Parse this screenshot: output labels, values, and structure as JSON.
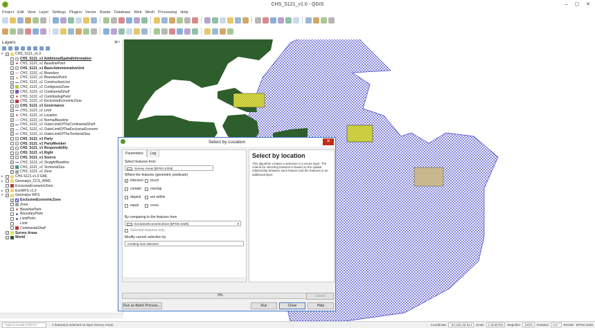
{
  "window": {
    "title": "CHS_S121_v1.0 - QGIS",
    "controls": "– ▢ ✕"
  },
  "menu": [
    "Project",
    "Edit",
    "View",
    "Layer",
    "Settings",
    "Plugins",
    "Vector",
    "Raster",
    "Database",
    "Web",
    "Mesh",
    "Processing",
    "Help"
  ],
  "layers_panel": {
    "title": "Layers",
    "items": [
      {
        "label": "CHS_S121_v1.0",
        "style": "plain",
        "indent": 0,
        "checked": true,
        "expand": "▾",
        "swatch": "group"
      },
      {
        "label": "CHS_S121_v1 AdditionalSpatialInformation",
        "style": "bd ul",
        "indent": 1,
        "checked": false,
        "expand": "",
        "swatch": "table"
      },
      {
        "label": "CHS_S121_v1 BaselinePoint",
        "style": "it",
        "indent": 1,
        "checked": true,
        "expand": "",
        "swatch": "point"
      },
      {
        "label": "CHS_S121_v1 BasicAdministrativeUnit",
        "style": "bd",
        "indent": 1,
        "checked": false,
        "expand": "",
        "swatch": "table"
      },
      {
        "label": "CHS_S121_v1 Boundary",
        "style": "it",
        "indent": 1,
        "checked": true,
        "expand": "",
        "swatch": "line"
      },
      {
        "label": "CHS_S121_v1 BoundaryPoint",
        "style": "it",
        "indent": 1,
        "checked": true,
        "expand": "",
        "swatch": "pointo"
      },
      {
        "label": "CHS_S121_v1 ConstructionLine",
        "style": "it",
        "indent": 1,
        "checked": true,
        "expand": "",
        "swatch": "line"
      },
      {
        "label": "CHS_S121_v1 ContiguousZone",
        "style": "it",
        "indent": 1,
        "checked": true,
        "expand": "",
        "swatch": "green"
      },
      {
        "label": "CHS_S121_v1 ContinentalShelf",
        "style": "it",
        "indent": 1,
        "checked": true,
        "expand": "",
        "swatch": "purple"
      },
      {
        "label": "CHS_S121_v1 ContributingPoint",
        "style": "it",
        "indent": 1,
        "checked": true,
        "expand": "",
        "swatch": "pointr"
      },
      {
        "label": "CHS_S121_v1 ExclusiveEconomicZone",
        "style": "it",
        "indent": 1,
        "checked": true,
        "expand": "",
        "swatch": "red"
      },
      {
        "label": "CHS_S121_v1 Governance",
        "style": "bd",
        "indent": 1,
        "checked": false,
        "expand": "",
        "swatch": "table"
      },
      {
        "label": "CHS_S121_v1 Limit",
        "style": "it",
        "indent": 1,
        "checked": true,
        "expand": "",
        "swatch": "line"
      },
      {
        "label": "CHS_S121_v1 Location",
        "style": "it",
        "indent": 1,
        "checked": true,
        "expand": "",
        "swatch": "point"
      },
      {
        "label": "CHS_S121_v1 NormalBaseline",
        "style": "it",
        "indent": 1,
        "checked": true,
        "expand": "",
        "swatch": "line"
      },
      {
        "label": "CHS_S121_v1 OuterLimitOfTheContinentalShelf",
        "style": "it",
        "indent": 1,
        "checked": true,
        "expand": "",
        "swatch": "line"
      },
      {
        "label": "CHS_S121_v1 OuterLimitOfTheExclusiveEconomi",
        "style": "it",
        "indent": 1,
        "checked": true,
        "expand": "",
        "swatch": "line"
      },
      {
        "label": "CHS_S121_v1 OuterLimitOfTheTerritorialSea",
        "style": "it",
        "indent": 1,
        "checked": true,
        "expand": "",
        "swatch": "line"
      },
      {
        "label": "CHS_S121_v1 Party",
        "style": "bd",
        "indent": 1,
        "checked": false,
        "expand": "",
        "swatch": "table"
      },
      {
        "label": "CHS_S121_v1 PartyMember",
        "style": "bd",
        "indent": 1,
        "checked": false,
        "expand": "",
        "swatch": "table"
      },
      {
        "label": "CHS_S121_v1 Responsibility",
        "style": "bd",
        "indent": 1,
        "checked": false,
        "expand": "",
        "swatch": "table"
      },
      {
        "label": "CHS_S121_v1 Right",
        "style": "bd",
        "indent": 1,
        "checked": false,
        "expand": "",
        "swatch": "table"
      },
      {
        "label": "CHS_S121_v1 Source",
        "style": "bd",
        "indent": 1,
        "checked": false,
        "expand": "",
        "swatch": "table"
      },
      {
        "label": "CHS_S121_v1 StraightBaseline",
        "style": "it",
        "indent": 1,
        "checked": true,
        "expand": "",
        "swatch": "line"
      },
      {
        "label": "CHS_S121_v1 TerritorialSea",
        "style": "it",
        "indent": 1,
        "checked": true,
        "expand": "",
        "swatch": "teal"
      },
      {
        "label": "CHS_S121_v1 Zone",
        "style": "it",
        "indent": 1,
        "checked": true,
        "expand": "",
        "swatch": "gray"
      },
      {
        "label": "CHS S121 v1.0 GML",
        "style": "plain",
        "indent": 0,
        "checked": false,
        "expand": "▸",
        "swatch": "group"
      },
      {
        "label": "Geomatys_CCS_WMS",
        "style": "plain",
        "indent": 0,
        "checked": false,
        "expand": "▸",
        "swatch": "group"
      },
      {
        "label": "ExclusiveEconomicZone",
        "style": "it",
        "indent": 0,
        "checked": false,
        "expand": "",
        "swatch": "red"
      },
      {
        "label": "EsriWFS v1.0",
        "style": "plain",
        "indent": 0,
        "checked": false,
        "expand": "▸",
        "swatch": "group"
      },
      {
        "label": "Geomatys WFS",
        "style": "plain",
        "indent": 0,
        "checked": true,
        "expand": "▾",
        "swatch": "group"
      },
      {
        "label": "ExclusiveEconomicZone",
        "style": "bd",
        "indent": 1,
        "checked": true,
        "expand": "",
        "swatch": "hatch"
      },
      {
        "label": "Zone",
        "style": "it",
        "indent": 1,
        "checked": false,
        "expand": "",
        "swatch": "gray"
      },
      {
        "label": "BaselinePoint",
        "style": "it",
        "indent": 1,
        "checked": false,
        "expand": "",
        "swatch": "pointr"
      },
      {
        "label": "BoundaryPoint",
        "style": "it",
        "indent": 1,
        "checked": false,
        "expand": "",
        "swatch": "pointb"
      },
      {
        "label": "LimitPoint",
        "style": "it",
        "indent": 1,
        "checked": false,
        "expand": "",
        "swatch": "pointb"
      },
      {
        "label": "Limit",
        "style": "it",
        "indent": 1,
        "checked": false,
        "expand": "",
        "swatch": "none"
      },
      {
        "label": "ContinentalShelf",
        "style": "it",
        "indent": 1,
        "checked": false,
        "expand": "",
        "swatch": "red"
      },
      {
        "label": "Survey Areas",
        "style": "bd",
        "indent": 0,
        "checked": true,
        "expand": "",
        "swatch": "yellow"
      },
      {
        "label": "World",
        "style": "bd",
        "indent": 0,
        "checked": true,
        "expand": "",
        "swatch": "darkgreen"
      }
    ]
  },
  "dialog": {
    "title": "Select by Location",
    "tabs": [
      "Parameters",
      "Log"
    ],
    "select_from_label": "Select features from",
    "select_from_value": "Survey Areas [EPSG:4326]",
    "predicate_label": "Where the features (geometric predicate)",
    "predicates": [
      {
        "label": "intersect",
        "checked": true
      },
      {
        "label": "touch",
        "checked": false
      },
      {
        "label": "contain",
        "checked": false
      },
      {
        "label": "overlap",
        "checked": false
      },
      {
        "label": "disjoint",
        "checked": false
      },
      {
        "label": "are within",
        "checked": false
      },
      {
        "label": "equal",
        "checked": false
      },
      {
        "label": "cross",
        "checked": false
      }
    ],
    "compare_label": "By comparing to the features from",
    "compare_value": "ExclusiveEconomicZone [EPSG:4326]",
    "selected_only": "Selected features only",
    "modify_label": "Modify current selection by",
    "modify_value": "creating new selection",
    "help_title": "Select by location",
    "help_text": "This algorithm creates a selection in a vector layer. The criteria for selecting features is based on the spatial relationship between each feature and the features in an additional layer.",
    "progress": "0%",
    "progress_value": 0,
    "cancel": "Cancel",
    "batch": "Run as Batch Process...",
    "run": "Run",
    "close": "Close",
    "help": "Help"
  },
  "status": {
    "search_placeholder": "Type to locate (Ctrl+K)",
    "message": "1 feature(s) selected on layer Survey Areas.",
    "coordinate_label": "Coordinate",
    "coordinate": "-63.430,48.914",
    "scale_label": "Scale",
    "scale": "1:3236754",
    "magnifier_label": "Magnifier",
    "magnifier": "100%",
    "rotation_label": "Rotation",
    "rotation": "0.0 °",
    "render": "Render",
    "crs": "EPSG:4326"
  },
  "colors": {
    "water_hatch": "#3e3ec9",
    "land": "#2e5e2c",
    "survey": "#e3e54a",
    "survey_brown": "#c9b88d",
    "accent": "#3c78c8",
    "close_red": "#c42b1c"
  }
}
